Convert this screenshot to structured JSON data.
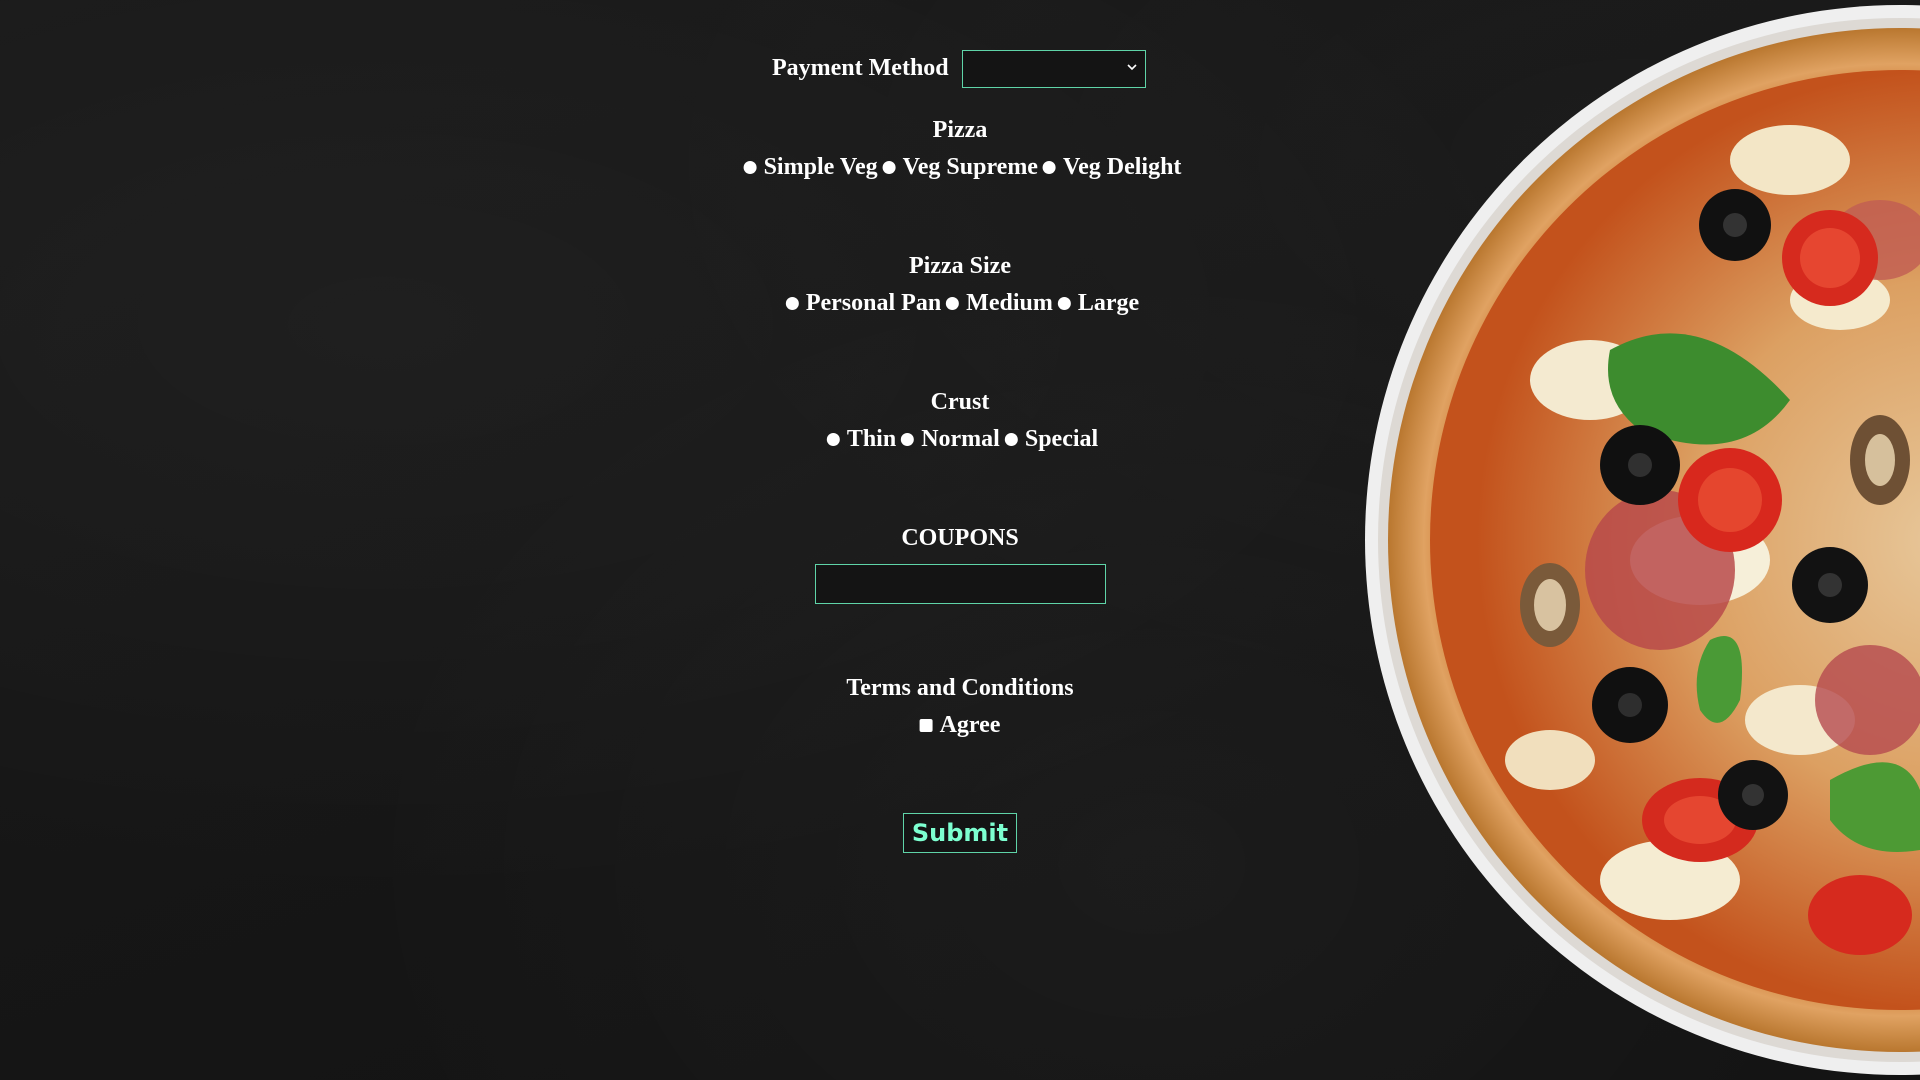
{
  "payment": {
    "label": "Payment Method",
    "selected": ""
  },
  "pizza": {
    "heading": "Pizza",
    "options": [
      "Simple Veg",
      "Veg Supreme",
      "Veg Delight"
    ]
  },
  "size": {
    "heading": "Pizza Size",
    "options": [
      "Personal Pan",
      "Medium",
      "Large"
    ]
  },
  "crust": {
    "heading": "Crust",
    "options": [
      "Thin",
      "Normal",
      "Special"
    ]
  },
  "coupons": {
    "heading": "COUPONS",
    "value": ""
  },
  "terms": {
    "heading": "Terms and Conditions",
    "agree_label": "Agree"
  },
  "submit": {
    "label": "Submit"
  },
  "colors": {
    "background": "#141414",
    "accent_border": "#5fd4a8",
    "submit_text": "#7dffd0",
    "text": "#ffffff"
  },
  "icons": {
    "select_chevron": "chevron-down-icon"
  }
}
